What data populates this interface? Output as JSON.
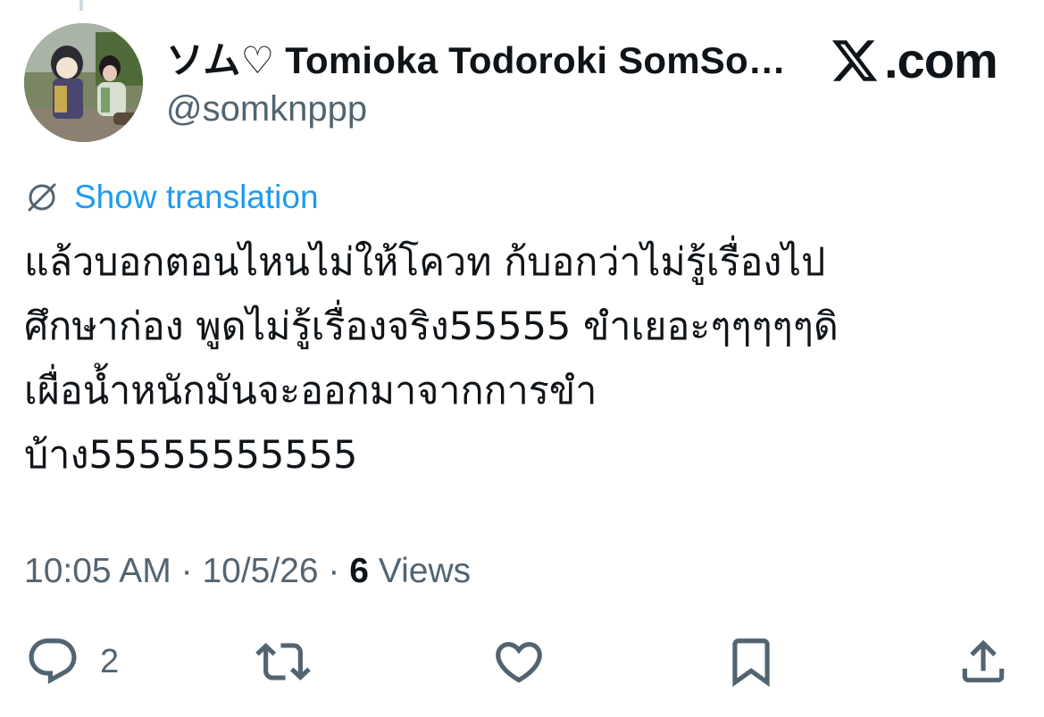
{
  "user": {
    "display_name": "ソム♡ Tomioka Todoroki SomSo…",
    "handle": "@somknppp"
  },
  "brand": {
    "text": ".com",
    "icon": "x-logo-icon"
  },
  "translation": {
    "label": "Show translation",
    "icon": "globe-icon"
  },
  "tweet": {
    "lines": [
      "แล้วบอกตอนไหนไม่ให้โควท ก้บอกว่าไม่รู้เรื่องไป",
      "ศึกษาก่อง พูดไม่รู้เรื่องจริง55555 ขำเยอะๆๆๆๆๆดิ",
      "เผื่อน้ำหนักมันจะออกมาจากการขำ",
      "บ้าง55555555555"
    ]
  },
  "meta": {
    "time": "10:05 AM",
    "separator": " · ",
    "date": "10/5/26",
    "views_count": "6",
    "views_label": " Views"
  },
  "actions": {
    "reply_count": "2",
    "icons": [
      "reply-icon",
      "retweet-icon",
      "like-icon",
      "bookmark-icon",
      "share-icon"
    ]
  },
  "colors": {
    "text": "#0f1419",
    "secondary": "#536471",
    "link": "#1d9bf0"
  }
}
